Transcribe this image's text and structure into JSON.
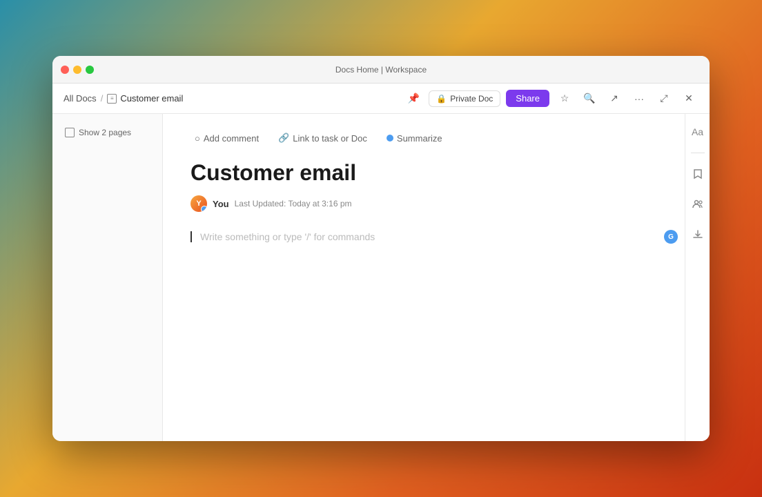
{
  "window": {
    "title": "Docs Home | Workspace"
  },
  "breadcrumb": {
    "root": "All Docs",
    "separator": "/",
    "current": "Customer email"
  },
  "toolbar": {
    "private_doc_label": "Private Doc",
    "share_label": "Share"
  },
  "sidebar": {
    "show_pages_label": "Show 2 pages"
  },
  "doc_toolbar": {
    "add_comment": "Add comment",
    "link_task": "Link to task or Doc",
    "summarize": "Summarize"
  },
  "document": {
    "title": "Customer email",
    "author": "You",
    "updated_label": "Last Updated:",
    "updated_time": "Today at 3:16 pm",
    "placeholder": "Write something or type '/' for commands"
  },
  "right_sidebar": {
    "icons": [
      "format",
      "divider",
      "star-right",
      "user",
      "download"
    ]
  }
}
